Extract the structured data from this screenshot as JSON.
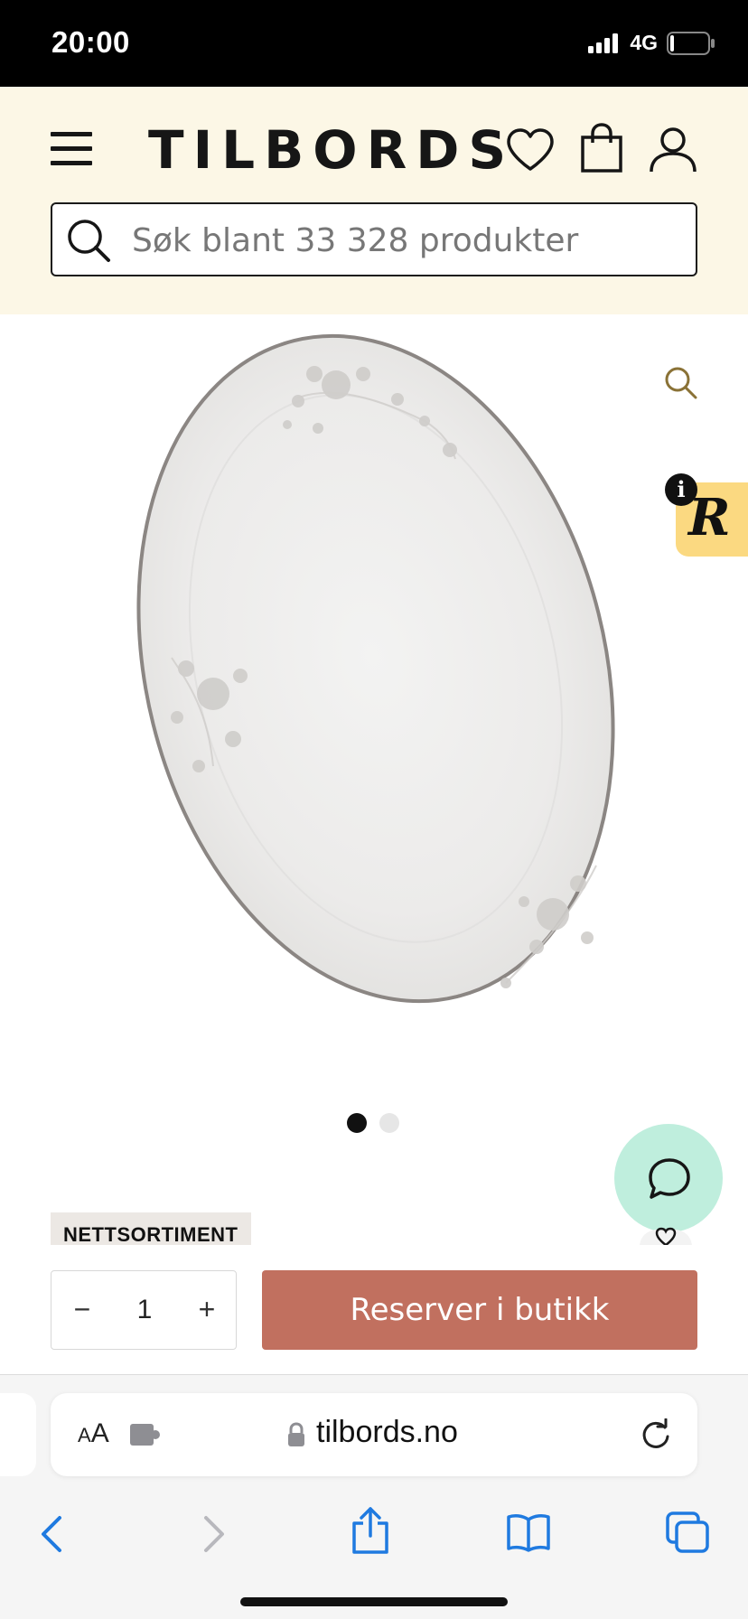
{
  "status_bar": {
    "time": "20:00",
    "network": "4G",
    "icons": [
      "signal-icon",
      "battery-icon"
    ]
  },
  "header": {
    "logo": "TILBORDS",
    "icons": [
      "menu-icon",
      "heart-icon",
      "shopping-bag-icon",
      "user-icon"
    ],
    "search": {
      "placeholder": "Søk blant 33 328 produkter",
      "icon": "search-icon"
    }
  },
  "product": {
    "image_icon": "zoom-icon",
    "carousel": {
      "total": 2,
      "active_index": 0
    },
    "badge": "NETTSORTIMENT",
    "reviews_widget": {
      "info_label": "i",
      "logo_letter": "R"
    },
    "chat_icon": "chat-icon"
  },
  "purchase": {
    "decrement_label": "−",
    "quantity": "1",
    "increment_label": "+",
    "reserve_label": "Reserver i butikk"
  },
  "browser": {
    "text_size_small": "A",
    "text_size_large": "A",
    "url": "tilbords.no",
    "icons": [
      "puzzle-icon",
      "lock-icon",
      "reload-icon",
      "back-icon",
      "forward-icon",
      "share-icon",
      "bookmarks-icon",
      "tabs-icon"
    ]
  },
  "colors": {
    "header_bg": "#fcf7e6",
    "accent_button": "#c1705f",
    "chat_bg": "#bfeedd",
    "reviews_bg": "#fbd981"
  }
}
